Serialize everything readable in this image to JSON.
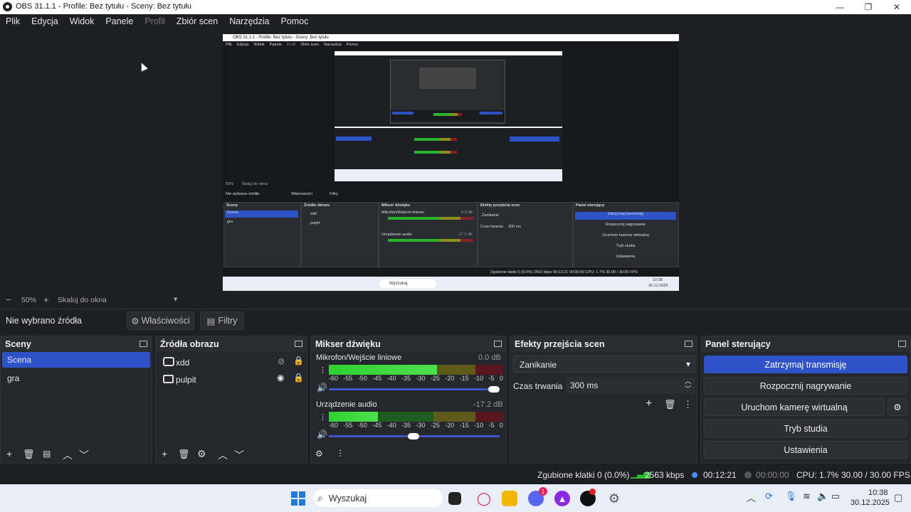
{
  "window": {
    "title": "OBS 31.1.1 - Profile: Bez tytułu - Sceny: Bez tytułu",
    "min": "—",
    "max": "❐",
    "close": "✕"
  },
  "menu": [
    "Plik",
    "Edycja",
    "Widok",
    "Panele",
    "Profil",
    "Zbiór scen",
    "Narzędzia",
    "Pomoc"
  ],
  "preview_nested": {
    "title": "OBS 31.1.1 - Profile: Bez tytułu - Sceny: Bez tytułu",
    "menu": [
      "Plik",
      "Edycja",
      "Widok",
      "Panele",
      "Profil",
      "Zbiór scen",
      "Narzędzia",
      "Pomoc"
    ],
    "zoom": "50%",
    "scale_label": "Skaluj do okna",
    "no_source": "Nie wybrano źródła",
    "props": "Właściwości",
    "filters": "Filtry",
    "docks": [
      "Sceny",
      "Źródła obrazu",
      "Mikser dźwięku",
      "Efekty przejścia scen",
      "Panel sterujący"
    ],
    "scenes": [
      "Scena",
      "gra"
    ],
    "sources": [
      "xdd",
      "pulpit"
    ],
    "mic": "Mikrofon/Wejście liniowe",
    "mic_db": "0.0 dB",
    "aux": "Urządzenie audio",
    "aux_db": "-17.2 dB",
    "transition": "Zanikanie",
    "duration_label": "Czas trwania",
    "duration": "300 ms",
    "buttons": [
      "Zatrzymaj transmisję",
      "Rozpocznij nagrywanie",
      "Uruchom kamerę wirtualną",
      "Tryb studia",
      "Ustawienia"
    ],
    "status": "Zgubione klatki 0 (0.0%)   2563 kbps   00:12:21   00:00:00   CPU: 1.7%   30.00 / 30.00 FPS",
    "search": "Wyszukaj",
    "time": "10:38",
    "date": "30.12.2025"
  },
  "zoom": {
    "minus": "−",
    "value": "50%",
    "plus": "+",
    "scale": "Skaluj do okna",
    "caret": "▾"
  },
  "sourcebar": {
    "no_source": "Nie wybrano źródła",
    "props_icon": "gear-icon",
    "props": "Właściwości",
    "filters_icon": "filter-icon",
    "filters": "Filtry"
  },
  "scenes": {
    "title": "Sceny",
    "items": [
      "Scena",
      "gra"
    ]
  },
  "sources": {
    "title": "Źródła obrazu",
    "items": [
      {
        "name": "xdd",
        "icon": "camera-icon"
      },
      {
        "name": "pulpit",
        "icon": "monitor-icon"
      }
    ]
  },
  "mixer": {
    "title": "Mikser dźwięku",
    "channels": [
      {
        "name": "Mikrofon/Wejście liniowe",
        "db": "0.0 dB",
        "level": 0.62,
        "volume": 1.0
      },
      {
        "name": "Urządzenie audio",
        "db": "-17.2 dB",
        "level": 0.28,
        "volume": 0.53
      }
    ],
    "scale": [
      "-60",
      "-55",
      "-50",
      "-45",
      "-40",
      "-35",
      "-30",
      "-25",
      "-20",
      "-15",
      "-10",
      "-5",
      "0"
    ]
  },
  "transitions": {
    "title": "Efekty przejścia scen",
    "selected": "Zanikanie",
    "duration_label": "Czas trwania",
    "duration": "300 ms"
  },
  "controls": {
    "title": "Panel sterujący",
    "stop_stream": "Zatrzymaj transmisję",
    "start_record": "Rozpocznij nagrywanie",
    "virtual_cam": "Uruchom kamerę wirtualną",
    "studio": "Tryb studia",
    "settings": "Ustawienia",
    "accent": "#2f52c8"
  },
  "status": {
    "dropped": "Zgubione klatki 0 (0.0%)",
    "bitrate": "2563 kbps",
    "stream_time": "00:12:21",
    "rec_time": "00:00:00",
    "cpu": "CPU: 1.7%",
    "fps": "30.00 / 30.00 FPS"
  },
  "taskbar": {
    "search": "Wyszukaj",
    "time": "10:38",
    "date": "30.12.2025",
    "badge": "1"
  }
}
